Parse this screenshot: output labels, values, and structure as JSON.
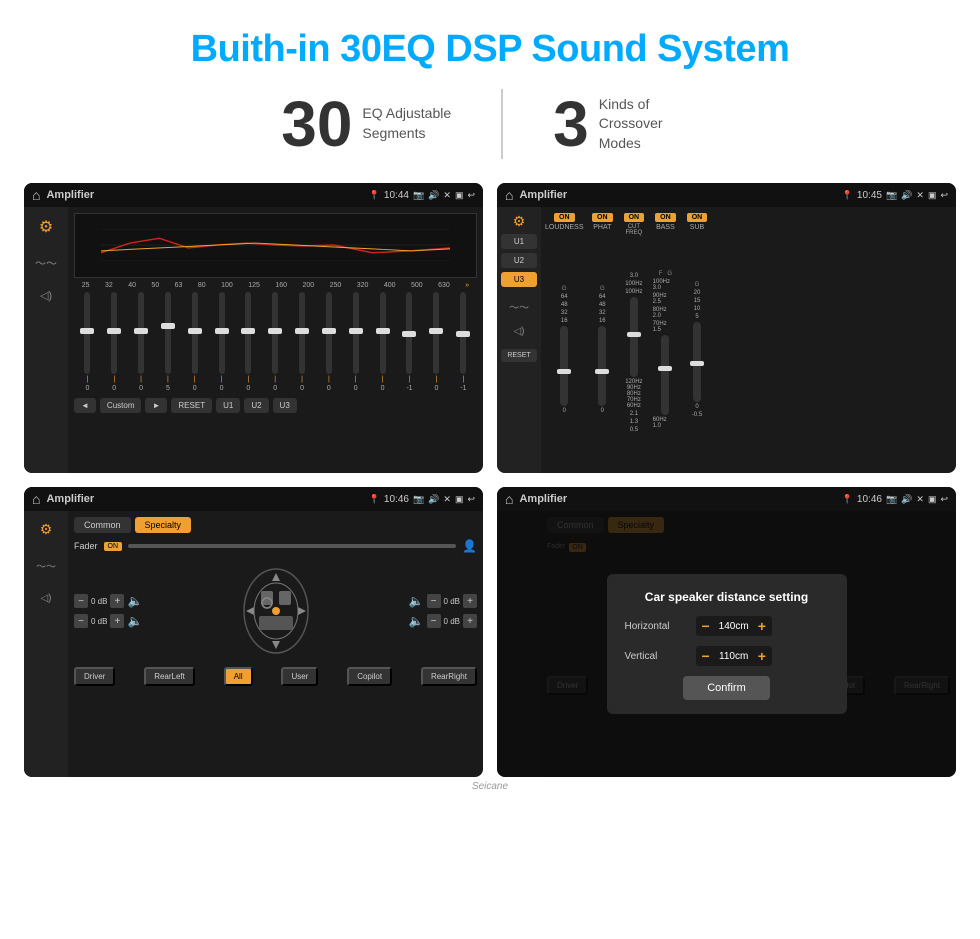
{
  "page": {
    "title": "Buith-in 30EQ DSP Sound System"
  },
  "stats": [
    {
      "number": "30",
      "label": "EQ Adjustable\nSegments"
    },
    {
      "number": "3",
      "label": "Kinds of\nCrossover Modes"
    }
  ],
  "screens": {
    "eq": {
      "title": "Amplifier",
      "time": "10:44",
      "graph_note": "EQ curve display",
      "freq_labels": [
        "25",
        "32",
        "40",
        "50",
        "63",
        "80",
        "100",
        "125",
        "160",
        "200",
        "250",
        "320",
        "400",
        "500",
        "630"
      ],
      "sliders": [
        {
          "pos": 50,
          "val": "0"
        },
        {
          "pos": 50,
          "val": "0"
        },
        {
          "pos": 50,
          "val": "0"
        },
        {
          "pos": 45,
          "val": "5"
        },
        {
          "pos": 50,
          "val": "0"
        },
        {
          "pos": 50,
          "val": "0"
        },
        {
          "pos": 50,
          "val": "0"
        },
        {
          "pos": 50,
          "val": "0"
        },
        {
          "pos": 50,
          "val": "0"
        },
        {
          "pos": 50,
          "val": "0"
        },
        {
          "pos": 50,
          "val": "0"
        },
        {
          "pos": 50,
          "val": "0"
        },
        {
          "pos": 52,
          "val": "-1"
        },
        {
          "pos": 50,
          "val": "0"
        },
        {
          "pos": 52,
          "val": "-1"
        }
      ],
      "footer_buttons": [
        "◄",
        "Custom",
        "►",
        "RESET",
        "U1",
        "U2",
        "U3"
      ]
    },
    "crossover": {
      "title": "Amplifier",
      "time": "10:45",
      "presets": [
        "U1",
        "U2",
        "U3"
      ],
      "active_preset": "U3",
      "bands": [
        {
          "name": "LOUDNESS",
          "on": true
        },
        {
          "name": "PHAT",
          "on": true
        },
        {
          "name": "CUT FREQ",
          "on": true
        },
        {
          "name": "BASS",
          "on": true
        },
        {
          "name": "SUB",
          "on": true
        }
      ],
      "reset_label": "RESET"
    },
    "speaker": {
      "title": "Amplifier",
      "time": "10:46",
      "tabs": [
        "Common",
        "Specialty"
      ],
      "active_tab": "Specialty",
      "fader_label": "Fader",
      "fader_on": true,
      "channels": [
        {
          "label": "0 dB"
        },
        {
          "label": "0 dB"
        },
        {
          "label": "0 dB"
        },
        {
          "label": "0 dB"
        }
      ],
      "footer_buttons": [
        "Driver",
        "RearLeft",
        "All",
        "User",
        "Copilot",
        "RearRight"
      ]
    },
    "dialog": {
      "title": "Amplifier",
      "time": "10:46",
      "dialog_title": "Car speaker distance setting",
      "fields": [
        {
          "label": "Horizontal",
          "value": "140cm"
        },
        {
          "label": "Vertical",
          "value": "110cm"
        }
      ],
      "confirm_label": "Confirm"
    }
  },
  "watermark": "Seicane"
}
